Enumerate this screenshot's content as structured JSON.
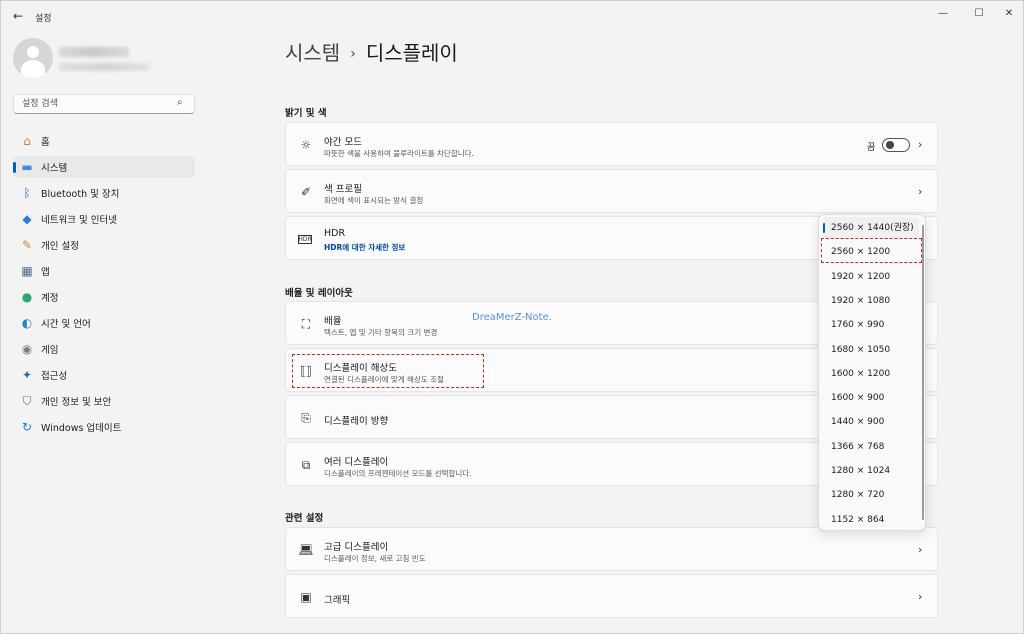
{
  "window": {
    "back_icon": "back-arrow-icon",
    "title": "설정",
    "controls": {
      "minimize": "—",
      "maximize": "☐",
      "close": "✕"
    }
  },
  "sidebar": {
    "search": {
      "placeholder": "설정 검색",
      "icon": "search-icon"
    },
    "items": [
      {
        "label": "홈",
        "icon": "home-icon",
        "glyph": "⌂",
        "color": "#d97b33",
        "selected": false
      },
      {
        "label": "시스템",
        "icon": "monitor-icon",
        "glyph": "▬",
        "color": "#3a8ee6",
        "selected": true
      },
      {
        "label": "Bluetooth 및 장치",
        "icon": "bluetooth-icon",
        "glyph": "ᛒ",
        "color": "#1e6fd9",
        "selected": false
      },
      {
        "label": "네트워크 및 인터넷",
        "icon": "wifi-icon",
        "glyph": "◆",
        "color": "#2a7de1",
        "selected": false
      },
      {
        "label": "개인 설정",
        "icon": "brush-icon",
        "glyph": "✎",
        "color": "#c98a3b",
        "selected": false
      },
      {
        "label": "앱",
        "icon": "apps-icon",
        "glyph": "▦",
        "color": "#4f6b8a",
        "selected": false
      },
      {
        "label": "계정",
        "icon": "account-icon",
        "glyph": "●",
        "color": "#2aa872",
        "selected": false
      },
      {
        "label": "시간 및 언어",
        "icon": "globe-clock-icon",
        "glyph": "◐",
        "color": "#2b83c9",
        "selected": false
      },
      {
        "label": "게임",
        "icon": "gamepad-icon",
        "glyph": "◉",
        "color": "#7d7d7d",
        "selected": false
      },
      {
        "label": "접근성",
        "icon": "accessibility-icon",
        "glyph": "✦",
        "color": "#1f6fc9",
        "selected": false
      },
      {
        "label": "개인 정보 및 보안",
        "icon": "shield-icon",
        "glyph": "⛉",
        "color": "#6f6f6f",
        "selected": false
      },
      {
        "label": "Windows 업데이트",
        "icon": "update-icon",
        "glyph": "↻",
        "color": "#1b76d6",
        "selected": false
      }
    ]
  },
  "header": {
    "crumb_parent": "시스템",
    "separator": "›",
    "crumb_current": "디스플레이"
  },
  "sections": {
    "brightness": "밝기 및 색",
    "scale_layout": "배율 및 레이아웃",
    "related": "관련 설정"
  },
  "cards": {
    "night_mode": {
      "title": "야간 모드",
      "subtitle": "따뜻한 색을 사용하여 블루라이트를 차단합니다.",
      "toggle_label": "끔",
      "toggle_on": false,
      "icon": "brightness-icon"
    },
    "color_profile": {
      "title": "색 프로필",
      "subtitle": "화면에 색이 표시되는 방식 결정",
      "icon": "eyedropper-icon"
    },
    "hdr": {
      "title": "HDR",
      "subtitle": "HDR에 대한 자세한 정보",
      "icon": "hdr-icon"
    },
    "scale": {
      "title": "배율",
      "subtitle": "텍스트, 앱 및 기타 항목의 크기 변경",
      "icon": "scale-icon"
    },
    "resolution": {
      "title": "디스플레이 해상도",
      "subtitle": "연결된 디스플레이에 맞게 해상도 조절",
      "icon": "resolution-icon"
    },
    "orientation": {
      "title": "디스플레이 방향",
      "icon": "orientation-icon"
    },
    "multi_display": {
      "title": "여러 디스플레이",
      "subtitle": "디스플레이의 프레젠테이션 모드를 선택합니다.",
      "icon": "multi-display-icon"
    },
    "advanced_display": {
      "title": "고급 디스플레이",
      "subtitle": "디스플레이 정보, 새로 고침 빈도",
      "icon": "laptop-icon"
    },
    "graphics": {
      "title": "그래픽",
      "icon": "graphics-card-icon"
    }
  },
  "watermark": "DreaMerZ-Note.",
  "resolution_dropdown": {
    "selected": "2560 × 1440(권장)",
    "highlighted": "2560 × 1200",
    "options": [
      "2560 × 1440(권장)",
      "2560 × 1200",
      "1920 × 1200",
      "1920 × 1080",
      "1760 × 990",
      "1680 × 1050",
      "1600 × 1200",
      "1600 × 900",
      "1440 × 900",
      "1366 × 768",
      "1280 × 1024",
      "1280 × 720",
      "1152 × 864"
    ]
  },
  "colors": {
    "accent": "#005fb8",
    "highlight_border": "#c42b1c",
    "link": "#0047a0"
  }
}
